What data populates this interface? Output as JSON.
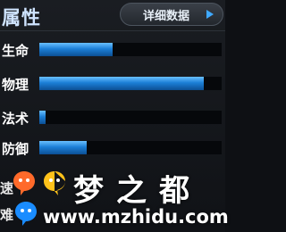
{
  "header": {
    "title": "属性",
    "details_button": "详细数据"
  },
  "stats": [
    {
      "label": "生命",
      "fill": 0.4
    },
    {
      "label": "物理",
      "fill": 0.9
    },
    {
      "label": "法术",
      "fill": 0.035
    },
    {
      "label": "防御",
      "fill": 0.26
    }
  ],
  "partial_rows": [
    "速",
    "难"
  ],
  "watermark": {
    "brand": "梦之都",
    "url": "www.mzhidu.com"
  },
  "colors": {
    "bar_fill": "#1c7fd6",
    "bar_track": "#06080b",
    "button_arrow": "#3fa9ff",
    "bubble_orange": "#ff6a2a",
    "bubble_yellow": "#ffc21a",
    "bubble_blue": "#1a8cff"
  }
}
